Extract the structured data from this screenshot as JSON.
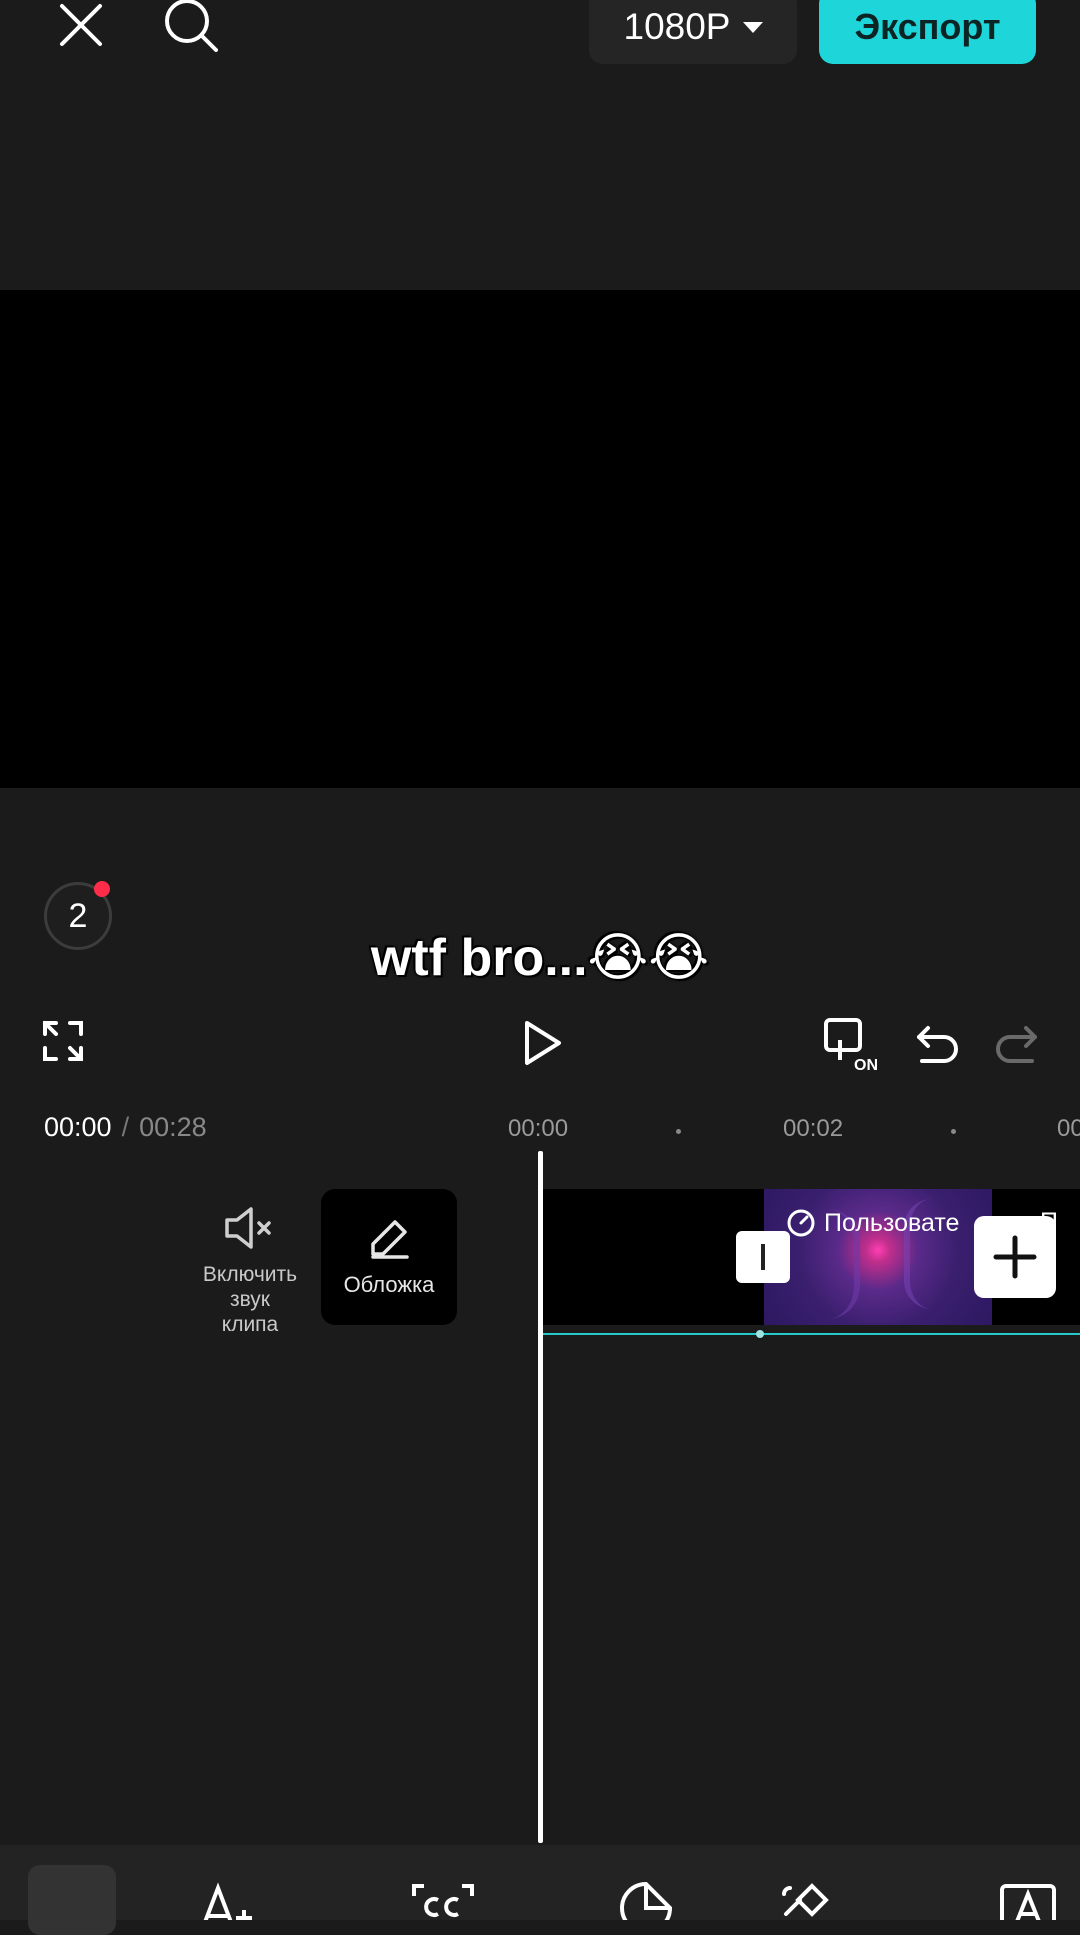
{
  "topbar": {
    "resolution": "1080P",
    "export_label": "Экспорт"
  },
  "preview": {
    "caption": "wtf bro...😭😭",
    "badge_count": "2"
  },
  "timeline": {
    "current_time": "00:00",
    "separator": "/",
    "total_time": "00:28",
    "ruler": [
      "00:00",
      "00:02",
      "00"
    ],
    "mute_label_lines": [
      "Включить",
      "звук",
      "клипа"
    ],
    "cover_label": "Обложка",
    "clip_label": "Пользовате",
    "clip_label_next": "П"
  },
  "colors": {
    "accent": "#1ed6d9",
    "background": "#1b1b1b",
    "badge_dot": "#ff2c4a"
  },
  "icons": {
    "close": "close-icon",
    "search": "search-icon",
    "fullscreen": "fullscreen-icon",
    "play": "play-icon",
    "keyframe_on": "keyframe-on-icon",
    "undo": "undo-icon",
    "redo": "redo-icon",
    "mute": "speaker-muted-icon",
    "edit": "pencil-icon",
    "add": "plus-icon"
  }
}
